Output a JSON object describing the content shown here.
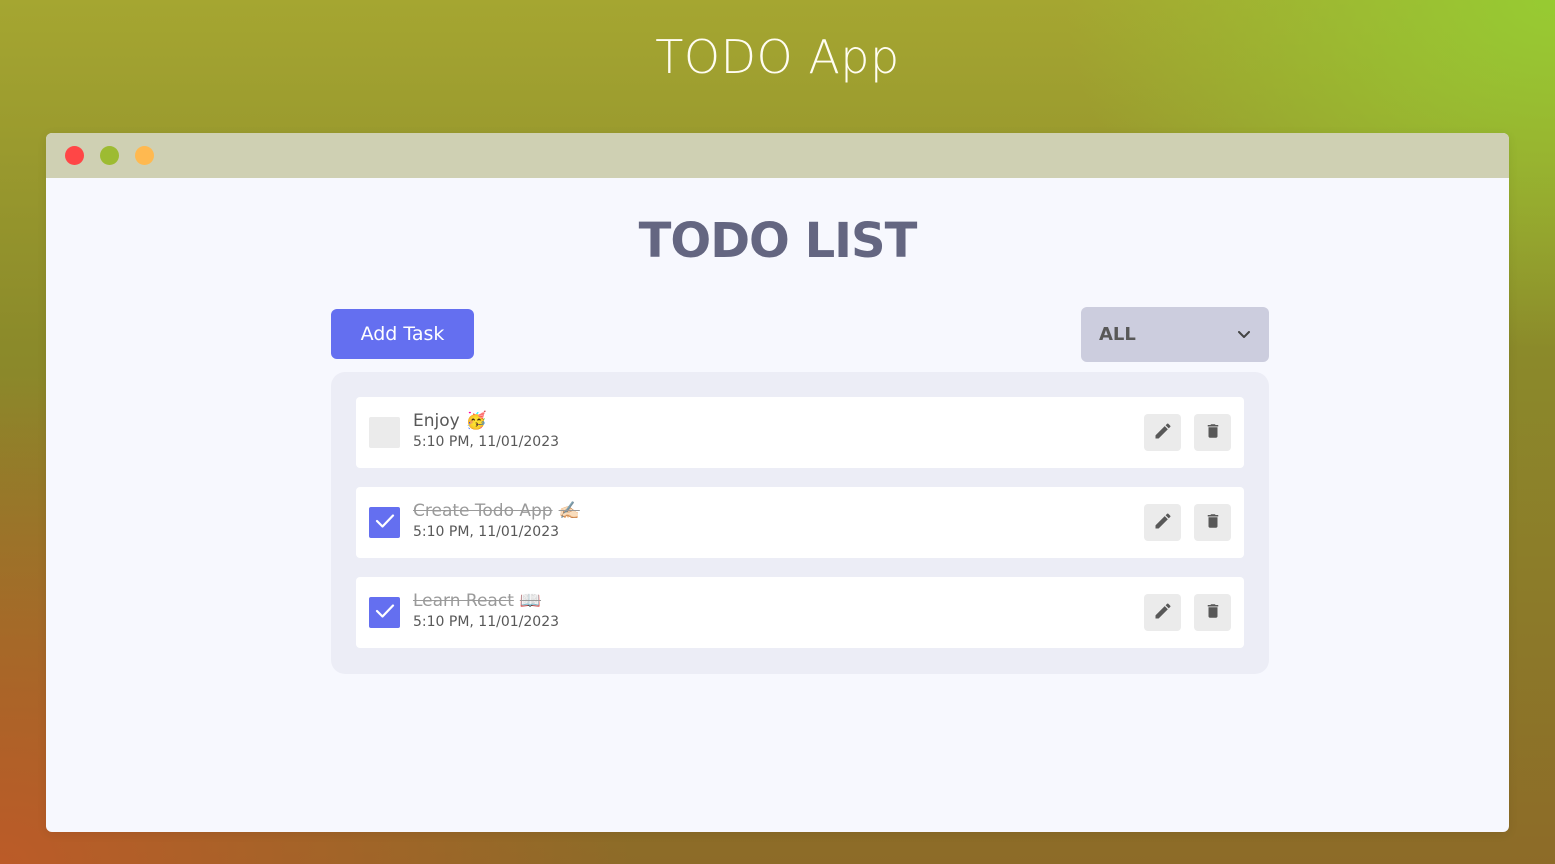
{
  "page": {
    "title": "TODO App"
  },
  "window": {
    "heading": "TODO LIST"
  },
  "toolbar": {
    "add_label": "Add Task",
    "filter_value": "ALL"
  },
  "colors": {
    "accent": "#646ff0",
    "heading": "#646681",
    "traffic_red": "#ff4646",
    "traffic_green": "#9dbb32",
    "traffic_yellow": "#ffb950"
  },
  "tasks": [
    {
      "title": "Enjoy",
      "emoji": "🥳",
      "time": "5:10 PM, 11/01/2023",
      "completed": false
    },
    {
      "title": "Create Todo App",
      "emoji": "✍🏻",
      "time": "5:10 PM, 11/01/2023",
      "completed": true
    },
    {
      "title": "Learn React",
      "emoji": "📖",
      "time": "5:10 PM, 11/01/2023",
      "completed": true
    }
  ],
  "icons": {
    "edit": "pencil-icon",
    "delete": "trash-icon",
    "check": "check-icon",
    "filter": "chevron-down-icon"
  }
}
